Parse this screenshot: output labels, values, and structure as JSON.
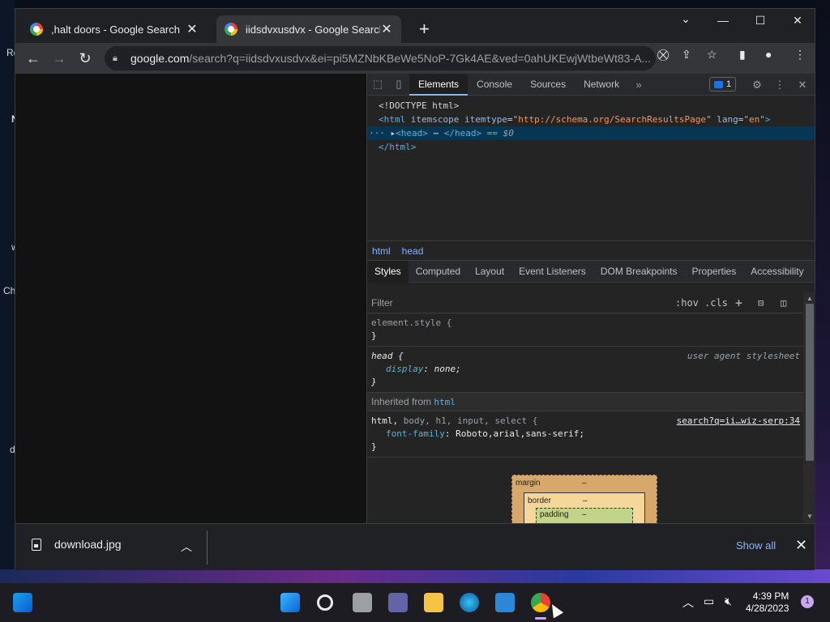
{
  "desktop": {
    "fragments": [
      "Re",
      "N",
      "w",
      "Ch",
      "d"
    ]
  },
  "browser": {
    "tabs": [
      {
        "title": ",halt doors - Google Search",
        "active": false
      },
      {
        "title": "iidsdvxusdvx - Google Search",
        "active": true
      }
    ],
    "omnibox": {
      "host": "google.com",
      "path": "/search?q=iidsdvxusdvx&ei=pi5MZNbKBeWe5NoP-7Gk4AE&ved=0ahUKEwjWtbeWt83-A..."
    }
  },
  "devtools": {
    "tabs": [
      "Elements",
      "Console",
      "Sources",
      "Network"
    ],
    "issues_count": "1",
    "dom": {
      "doctype": "<!DOCTYPE html>",
      "html_open_tag": "html",
      "html_attr1_name": "itemscope",
      "html_attr2_name": "itemtype",
      "html_attr2_value": "\"http://schema.org/SearchResultsPage\"",
      "html_attr3_name": "lang",
      "html_attr3_value": "\"en\"",
      "head_open": "<head>",
      "ellipsis": "⋯",
      "head_close": "</head>",
      "sel_marker": "== $0",
      "html_close": "</html>"
    },
    "breadcrumbs": [
      "html",
      "head"
    ],
    "pane_tabs": [
      "Styles",
      "Computed",
      "Layout",
      "Event Listeners",
      "DOM Breakpoints",
      "Properties",
      "Accessibility"
    ],
    "filter": {
      "placeholder": "Filter",
      "hov": ":hov",
      "cls": ".cls"
    },
    "rules": {
      "element_style": "element.style {",
      "close_brace": "}",
      "head_selector": "head {",
      "head_source": "user agent stylesheet",
      "head_prop": "display",
      "head_val": "none;",
      "inherited_label": "Inherited from",
      "inherited_tag": "html",
      "font_selector_main": "html,",
      "font_selector_rest": "body, h1, input, select {",
      "font_source": "search?q=ii…wiz-serp:34",
      "font_prop": "font-family",
      "font_val": "Roboto,arial,sans-serif;"
    },
    "box_model": {
      "margin": "margin",
      "border": "border",
      "padding": "padding",
      "dash": "–"
    }
  },
  "download_bar": {
    "filename": "download.jpg",
    "show_all": "Show all"
  },
  "taskbar": {
    "time": "4:39 PM",
    "date": "4/28/2023",
    "notifications": "1"
  }
}
